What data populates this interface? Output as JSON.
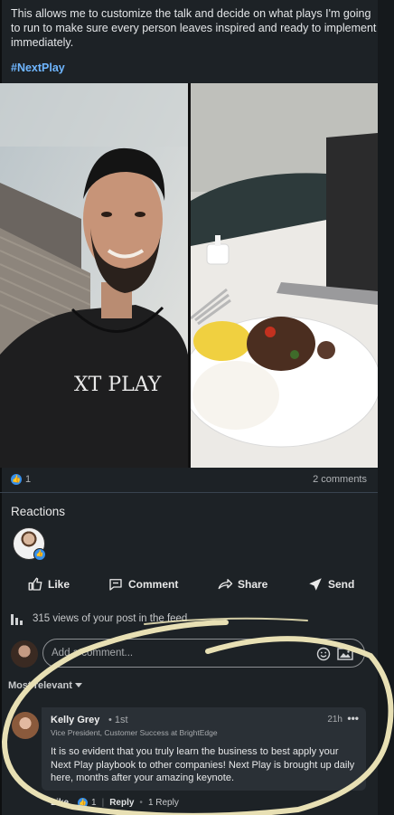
{
  "post": {
    "text": "This allows me to customize the talk and decide on what plays I'm going to run to make sure every person leaves inspired and ready to implement immediately.",
    "hashtag": "#NextPlay",
    "shirt_text": "XT PLAY"
  },
  "stats": {
    "reaction_count": "1",
    "comments": "2 comments"
  },
  "reactions": {
    "title": "Reactions"
  },
  "actions": {
    "like": "Like",
    "comment": "Comment",
    "share": "Share",
    "send": "Send"
  },
  "views": {
    "text": "315 views of your post in the feed"
  },
  "comment_box": {
    "placeholder": "Add a comment..."
  },
  "sort": {
    "label": "Most relevant"
  },
  "comment": {
    "author": "Kelly Grey",
    "degree": "• 1st",
    "title": "Vice President, Customer Success at BrightEdge",
    "time": "21h",
    "more": "•••",
    "body": "It is so evident that you truly learn the business to best apply your Next Play playbook to other companies! Next Play is brought up daily here, months after your amazing keynote.",
    "like": "Like",
    "like_count": "1",
    "reply": "Reply",
    "reply_count": "1 Reply"
  },
  "colors": {
    "background": "#1d2226",
    "accent": "#378fe9",
    "hashtag": "#6fb6ff",
    "annotation": "#e8e0b4"
  },
  "icons": [
    "like-icon",
    "comment-icon",
    "share-icon",
    "send-icon",
    "analytics-icon",
    "emoji-icon",
    "image-icon",
    "chevron-down-icon",
    "more-icon"
  ]
}
